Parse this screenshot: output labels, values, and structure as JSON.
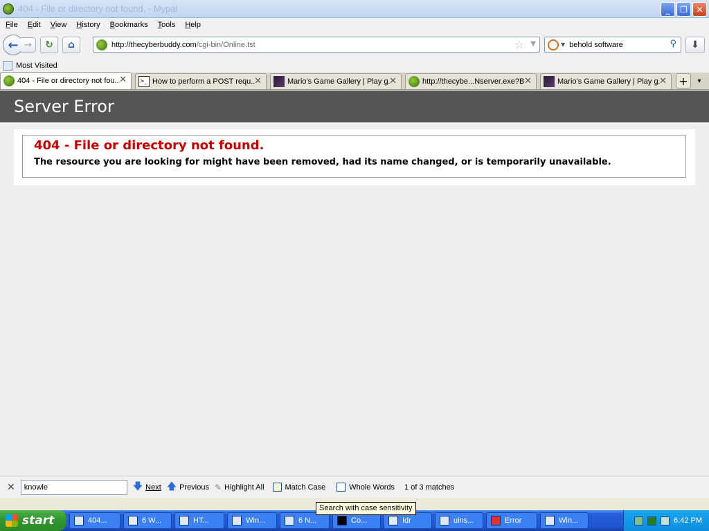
{
  "window": {
    "title": "404 - File or directory not found. - Mypal"
  },
  "menu": [
    "File",
    "Edit",
    "View",
    "History",
    "Bookmarks",
    "Tools",
    "Help"
  ],
  "nav": {
    "url_host": "http://thecyberbuddy.com",
    "url_path": "/cgi-bin/Online.tst",
    "search_value": "behold software"
  },
  "bookmarks": {
    "most_visited": "Most Visited"
  },
  "tabs": [
    {
      "title": "404 - File or directory not fou...",
      "icon": "green-face-icon",
      "active": true
    },
    {
      "title": "How to perform a POST requ...",
      "icon": "terminal-icon",
      "active": false
    },
    {
      "title": "Mario's Game Gallery | Play g...",
      "icon": "game-icon",
      "active": false
    },
    {
      "title": "http://thecybe...Nserver.exe?B",
      "icon": "green-face-icon",
      "active": false
    },
    {
      "title": "Mario's Game Gallery | Play g...",
      "icon": "game-icon",
      "active": false
    }
  ],
  "page": {
    "header": "Server Error",
    "error_title": "404 - File or directory not found.",
    "error_message": "The resource you are looking for might have been removed, had its name changed, or is temporarily unavailable."
  },
  "findbar": {
    "query": "knowle",
    "next": "Next",
    "previous": "Previous",
    "highlight_all": "Highlight All",
    "match_case": "Match Case",
    "whole_words": "Whole Words",
    "status": "1 of 3 matches",
    "tooltip": "Search with case sensitivity"
  },
  "taskbar": {
    "start": "start",
    "items": [
      "404...",
      "6 W...",
      "HT...",
      "Win...",
      "6 N...",
      "Co...",
      "Idr",
      "uins...",
      "Error",
      "Win..."
    ],
    "clock": "6:42 PM"
  },
  "colors": {
    "error_red": "#cc0000",
    "header_bg": "#555555",
    "content_bg": "#eeeeee"
  }
}
